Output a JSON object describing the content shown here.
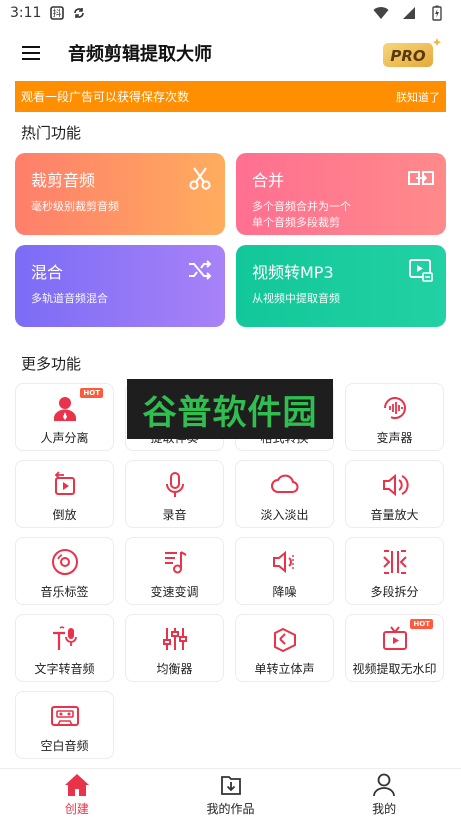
{
  "status_bar": {
    "time": "3:11"
  },
  "app": {
    "title": "音频剪辑提取大师",
    "pro_badge": "PRO"
  },
  "banner": {
    "text": "观看一段广告可以获得保存次数",
    "dismiss": "朕知道了"
  },
  "sections": {
    "hot": "热门功能",
    "more": "更多功能"
  },
  "cards": [
    {
      "title": "裁剪音频",
      "desc": "毫秒级别裁剪音频",
      "icon": "scissors-icon",
      "color_from": "#ff7e6b",
      "color_to": "#ffad5e"
    },
    {
      "title": "合并",
      "desc": "多个音频合并为一个单个音频多段裁剪",
      "desc_line1": "多个音频合并为一个",
      "desc_line2": "单个音频多段裁剪",
      "icon": "merge-icon",
      "color_from": "#ff6f91",
      "color_to": "#ff8a8a"
    },
    {
      "title": "混合",
      "desc": "多轨道音频混合",
      "icon": "shuffle-icon",
      "color_from": "#7b6cf6",
      "color_to": "#a882f7"
    },
    {
      "title": "视频转MP3",
      "desc": "从视频中提取音频",
      "icon": "video-convert-icon",
      "color_from": "#12c79a",
      "color_to": "#22d1a3"
    }
  ],
  "tiles": [
    {
      "label": "人声分离",
      "icon": "voice-separate-icon",
      "hot": "HOT"
    },
    {
      "label": "提取伴奏",
      "icon": "accompaniment-icon"
    },
    {
      "label": "格式转换",
      "icon": "format-convert-icon"
    },
    {
      "label": "变声器",
      "icon": "voice-changer-icon"
    },
    {
      "label": "倒放",
      "icon": "reverse-play-icon"
    },
    {
      "label": "录音",
      "icon": "microphone-icon"
    },
    {
      "label": "淡入淡出",
      "icon": "cloud-icon"
    },
    {
      "label": "音量放大",
      "icon": "volume-up-icon"
    },
    {
      "label": "音乐标签",
      "icon": "music-disc-icon"
    },
    {
      "label": "变速变调",
      "icon": "music-note-icon"
    },
    {
      "label": "降噪",
      "icon": "volume-down-icon"
    },
    {
      "label": "多段拆分",
      "icon": "split-icon"
    },
    {
      "label": "文字转音频",
      "icon": "text-to-speech-icon"
    },
    {
      "label": "均衡器",
      "icon": "equalizer-icon"
    },
    {
      "label": "单转立体声",
      "icon": "stereo-icon"
    },
    {
      "label": "视频提取无水印",
      "icon": "tv-icon",
      "hot": "HOT"
    },
    {
      "label": "空白音频",
      "icon": "cassette-icon"
    }
  ],
  "watermark": "谷普软件园",
  "tabs": [
    {
      "label": "创建",
      "icon": "home-icon",
      "active": true
    },
    {
      "label": "我的作品",
      "icon": "download-folder-icon"
    },
    {
      "label": "我的",
      "icon": "user-icon"
    }
  ],
  "colors": {
    "accent": "#e8334a",
    "banner": "#ff8f00"
  }
}
